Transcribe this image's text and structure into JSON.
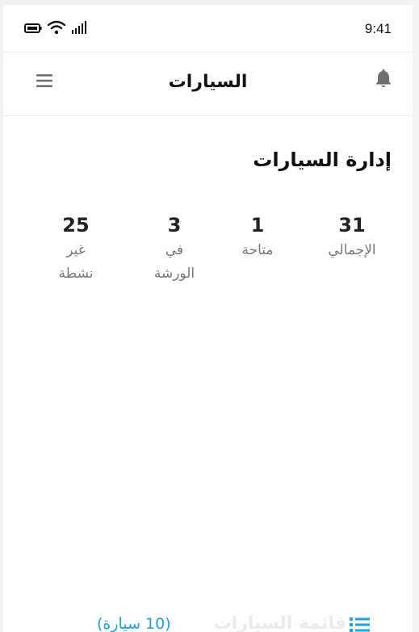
{
  "statusbar": {
    "time": "9:41"
  },
  "header": {
    "title": "السيارات"
  },
  "main": {
    "section_title": "إدارة السيارات",
    "stats": [
      {
        "value": "31",
        "label": "الإجمالي"
      },
      {
        "value": "1",
        "label": "متاحة"
      },
      {
        "value": "3",
        "label": "في الورشة"
      },
      {
        "value": "25",
        "label": "غير نشطة"
      }
    ],
    "list": {
      "title": "قائمة السيارات",
      "count": "(10 سيارة)"
    }
  },
  "colors": {
    "accent": "#1ea0dc",
    "icon_gray": "#6f6f6f"
  },
  "icons": [
    "battery-icon",
    "wifi-icon",
    "signal-icon",
    "menu-icon",
    "bell-icon",
    "list-icon"
  ]
}
